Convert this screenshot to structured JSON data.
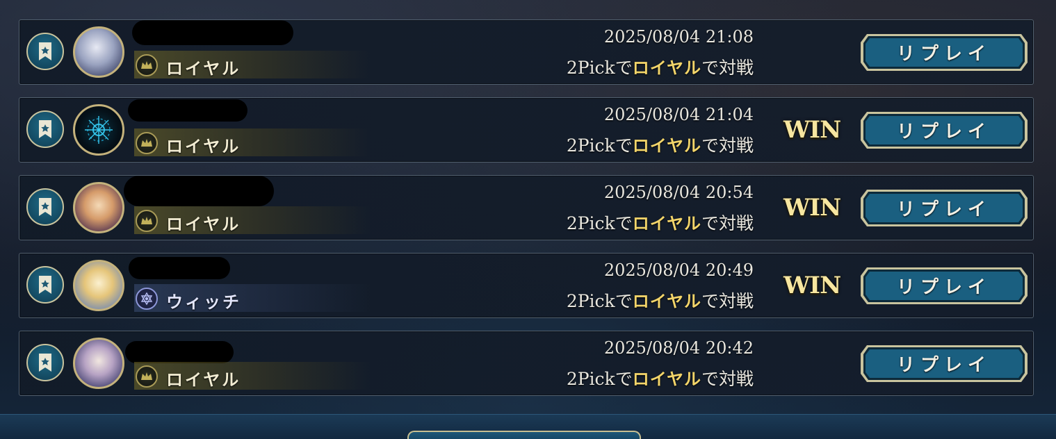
{
  "rows": [
    {
      "date": "2025/08/04 21:08",
      "desc_prefix": "2Pickで",
      "desc_class": "ロイヤル",
      "desc_suffix": "で対戦",
      "class_label": "ロイヤル",
      "result": "",
      "replay_label": "リプレイ"
    },
    {
      "date": "2025/08/04 21:04",
      "desc_prefix": "2Pickで",
      "desc_class": "ロイヤル",
      "desc_suffix": "で対戦",
      "class_label": "ロイヤル",
      "result": "WIN",
      "replay_label": "リプレイ"
    },
    {
      "date": "2025/08/04 20:54",
      "desc_prefix": "2Pickで",
      "desc_class": "ロイヤル",
      "desc_suffix": "で対戦",
      "class_label": "ロイヤル",
      "result": "WIN",
      "replay_label": "リプレイ"
    },
    {
      "date": "2025/08/04 20:49",
      "desc_prefix": "2Pickで",
      "desc_class": "ロイヤル",
      "desc_suffix": "で対戦",
      "class_label": "ウィッチ",
      "result": "WIN",
      "replay_label": "リプレイ"
    },
    {
      "date": "2025/08/04 20:42",
      "desc_prefix": "2Pickで",
      "desc_class": "ロイヤル",
      "desc_suffix": "で対戦",
      "class_label": "ロイヤル",
      "result": "",
      "replay_label": "リプレイ"
    }
  ],
  "icons": {
    "bookmark": "bookmark-star-icon",
    "royal": "crown-icon",
    "witch": "hexagram-icon"
  },
  "colors": {
    "highlight": "#f3d56a",
    "win": "#f7e6a0",
    "button_fill": "#1a5f80",
    "button_border": "#c9c49e"
  }
}
